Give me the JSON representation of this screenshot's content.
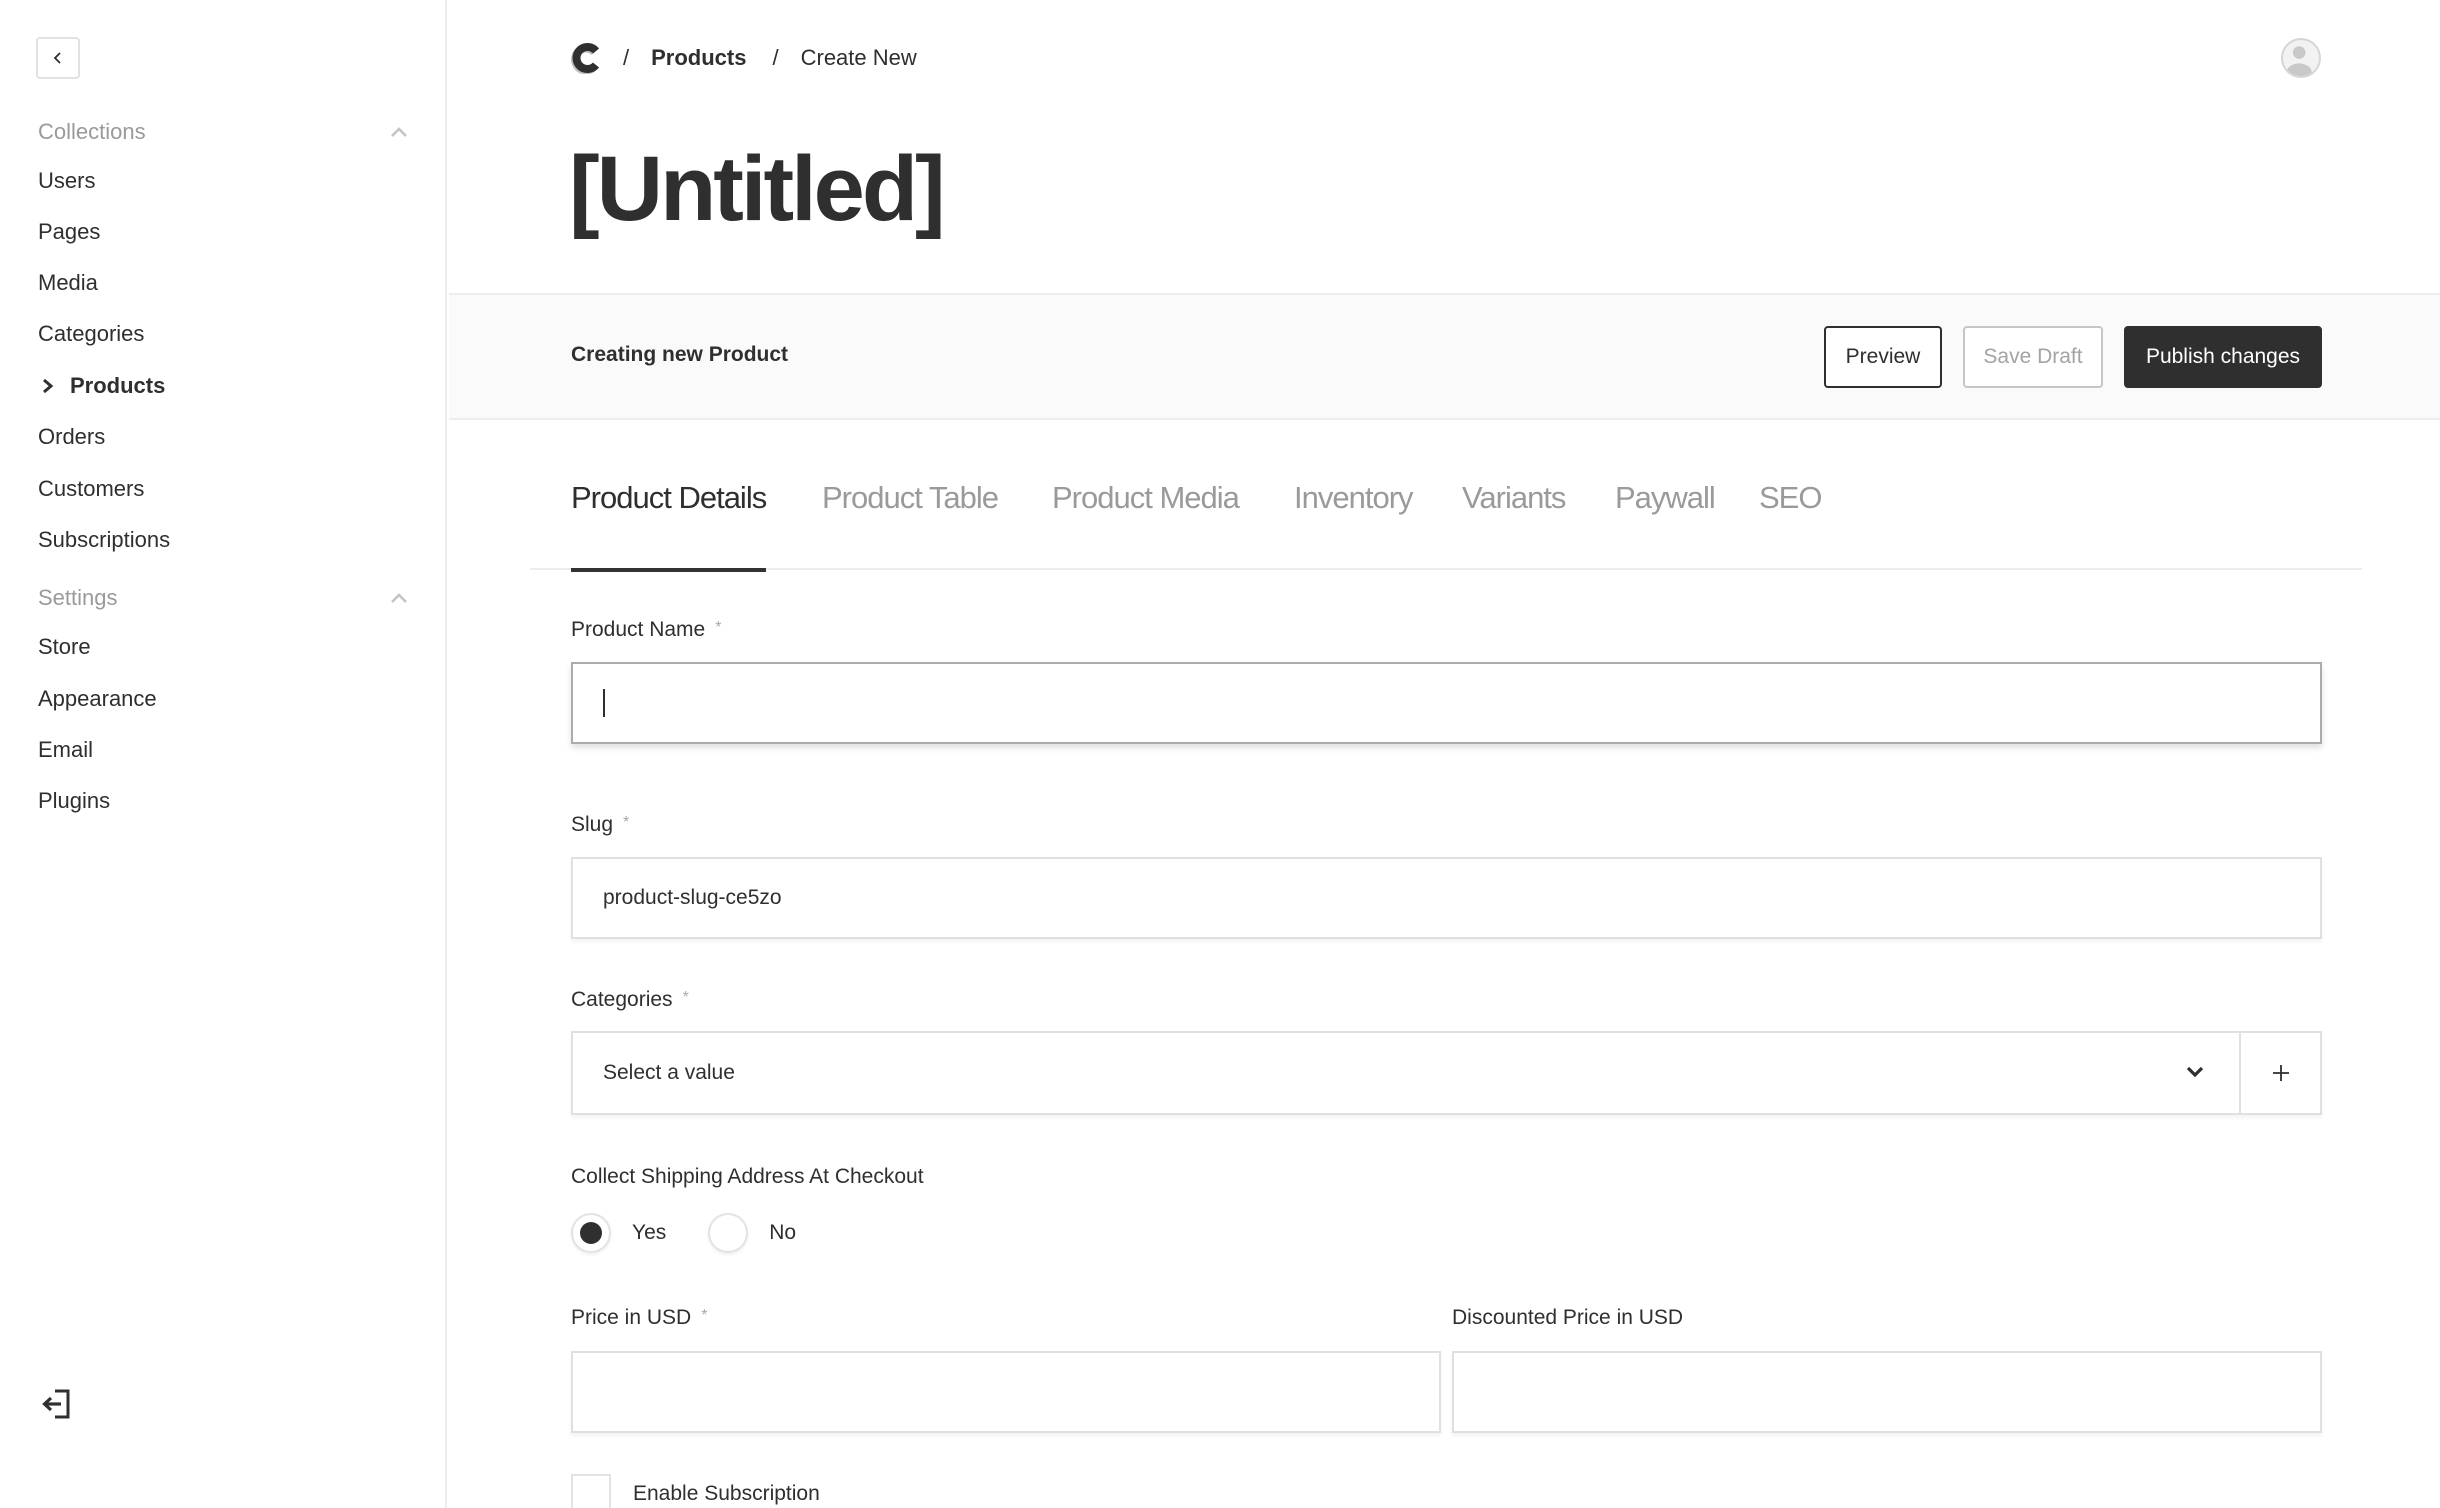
{
  "sidebar": {
    "collapse_icon": "chevron-left-icon",
    "groups": [
      {
        "label": "Collections",
        "expanded": true,
        "items": [
          {
            "label": "Users",
            "active": false
          },
          {
            "label": "Pages",
            "active": false
          },
          {
            "label": "Media",
            "active": false
          },
          {
            "label": "Categories",
            "active": false
          },
          {
            "label": "Products",
            "active": true
          },
          {
            "label": "Orders",
            "active": false
          },
          {
            "label": "Customers",
            "active": false
          },
          {
            "label": "Subscriptions",
            "active": false
          }
        ]
      },
      {
        "label": "Settings",
        "expanded": true,
        "items": [
          {
            "label": "Store",
            "active": false
          },
          {
            "label": "Appearance",
            "active": false
          },
          {
            "label": "Email",
            "active": false
          },
          {
            "label": "Plugins",
            "active": false
          }
        ]
      }
    ],
    "logout_icon": "logout-icon"
  },
  "header": {
    "logo_letter": "C",
    "breadcrumb": [
      {
        "label": "Products",
        "link": true
      },
      {
        "label": "Create New",
        "link": false
      }
    ],
    "separator": "/",
    "avatar_icon": "user-avatar-icon",
    "title": "[Untitled]"
  },
  "actionbar": {
    "status": "Creating new Product",
    "preview_label": "Preview",
    "save_draft_label": "Save Draft",
    "publish_label": "Publish changes"
  },
  "tabs": [
    {
      "label": "Product Details",
      "active": true
    },
    {
      "label": "Product Table",
      "active": false
    },
    {
      "label": "Product Media",
      "active": false
    },
    {
      "label": "Inventory",
      "active": false
    },
    {
      "label": "Variants",
      "active": false
    },
    {
      "label": "Paywall",
      "active": false
    },
    {
      "label": "SEO",
      "active": false
    }
  ],
  "form": {
    "required_marker": "*",
    "product_name": {
      "label": "Product Name",
      "value": "",
      "required": true,
      "focused": true
    },
    "slug": {
      "label": "Slug",
      "value": "product-slug-ce5zo",
      "required": true
    },
    "categories": {
      "label": "Categories",
      "placeholder": "Select a value",
      "required": true,
      "add_icon": "plus-icon"
    },
    "shipping": {
      "label": "Collect Shipping Address At Checkout",
      "options": [
        {
          "label": "Yes",
          "selected": true
        },
        {
          "label": "No",
          "selected": false
        }
      ]
    },
    "price": {
      "label": "Price in USD",
      "value": "",
      "required": true
    },
    "discounted_price": {
      "label": "Discounted Price in USD",
      "value": "",
      "required": false
    },
    "subscription": {
      "label": "Enable Subscription",
      "checked": false
    }
  },
  "colors": {
    "text": "#2f2f2f",
    "muted": "#9a9a9a",
    "primary_button": "#2f2f2f",
    "action_bar_bg": "#fafafa",
    "border": "#e0e0e0"
  }
}
